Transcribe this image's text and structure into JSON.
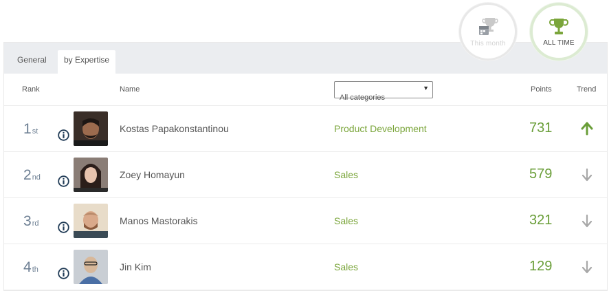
{
  "periods": {
    "this_month": {
      "label": "This month",
      "icon": "trophy-calendar-icon"
    },
    "all_time": {
      "label": "ALL TIME",
      "icon": "trophy-icon",
      "active": true
    }
  },
  "tabs": [
    {
      "label": "General",
      "active": false
    },
    {
      "label": "by Expertise",
      "active": true
    }
  ],
  "header": {
    "rank": "Rank",
    "name": "Name",
    "points": "Points",
    "trend": "Trend"
  },
  "category_filter": {
    "selected": "All categories"
  },
  "colors": {
    "accent_green": "#6a9e39",
    "trend_up": "#6a9e39",
    "trend_down": "#a8a8a8",
    "rank_text": "#6d7f93"
  },
  "rows": [
    {
      "rank": "1",
      "suffix": "st",
      "name": "Kostas Papakonstantinou",
      "category": "Product Development",
      "points": "731",
      "trend": "up"
    },
    {
      "rank": "2",
      "suffix": "nd",
      "name": "Zoey Homayun",
      "category": "Sales",
      "points": "579",
      "trend": "down"
    },
    {
      "rank": "3",
      "suffix": "rd",
      "name": "Manos Mastorakis",
      "category": "Sales",
      "points": "321",
      "trend": "down"
    },
    {
      "rank": "4",
      "suffix": "th",
      "name": "Jin Kim",
      "category": "Sales",
      "points": "129",
      "trend": "down"
    }
  ]
}
